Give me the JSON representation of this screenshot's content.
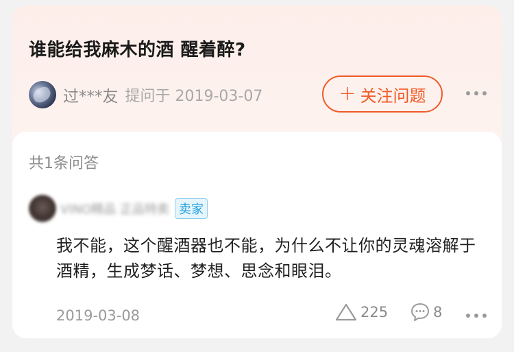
{
  "question": {
    "title": "谁能给我麻木的酒 醒着醉?",
    "asker_name": "过***友",
    "asked_meta": "提问于 2019-03-07",
    "follow_button_label": "关注问题",
    "follow_icon": "plus-icon",
    "more_icon": "more-dots-icon"
  },
  "answers_section": {
    "count_label": "共1条问答",
    "answer": {
      "answerer_name": "VINO精品 正品特卖",
      "seller_badge": "卖家",
      "text": "我不能，这个醒酒器也不能，为什么不让你的灵魂溶解于酒精，生成梦话、梦想、思念和眼泪。",
      "date": "2019-03-08",
      "likes": "225",
      "comments": "8",
      "like_icon": "triangle-up-icon",
      "comment_icon": "comment-bubble-icon",
      "more_icon": "more-dots-icon"
    }
  },
  "colors": {
    "accent": "#f05a28",
    "badge_blue": "#21a2de",
    "question_bg": "#fdeeea"
  }
}
